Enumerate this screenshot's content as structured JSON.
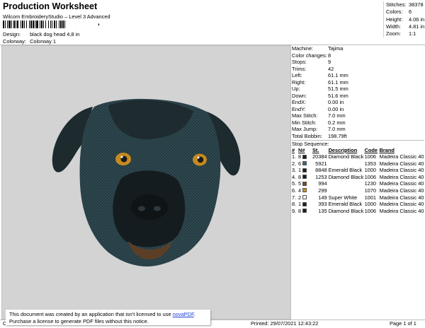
{
  "header": {
    "title": "Production Worksheet",
    "subtitle": "Wilcom EmbroideryStudio – Level 3 Advanced",
    "barcode_text": ",",
    "design_label": "Design:",
    "design_value": "black dog head 4,8 in",
    "colorway_label": "Colorway:",
    "colorway_value": "Colorway 1"
  },
  "stats": [
    {
      "label": "Stitches:",
      "value": "38378"
    },
    {
      "label": "Colors:",
      "value": "6"
    },
    {
      "label": "Height:",
      "value": "4.06 in"
    },
    {
      "label": "Width:",
      "value": "4.81 in"
    },
    {
      "label": "Zoom:",
      "value": "1:1"
    }
  ],
  "machine": [
    {
      "label": "Machine:",
      "value": "Tajima"
    },
    {
      "label": "Color changes:",
      "value": "8"
    },
    {
      "label": "Stops:",
      "value": "9"
    },
    {
      "label": "Trims:",
      "value": "42"
    },
    {
      "label": "Left:",
      "value": "61.1 mm"
    },
    {
      "label": "Right:",
      "value": "61.1 mm"
    },
    {
      "label": "Up:",
      "value": "51.5 mm"
    },
    {
      "label": "Down:",
      "value": "51.6 mm"
    },
    {
      "label": "EndX:",
      "value": "0.00 in"
    },
    {
      "label": "EndY:",
      "value": "0.00 in"
    },
    {
      "label": "Max Stitch:",
      "value": "7.0 mm"
    },
    {
      "label": "Min Stitch:",
      "value": "0.2 mm"
    },
    {
      "label": "Max Jump:",
      "value": "7.0 mm"
    },
    {
      "label": "Total Bobbin:",
      "value": "198.79ft"
    }
  ],
  "stop_sequence": {
    "heading": "Stop Sequence:",
    "columns": {
      "num": "#",
      "n": "N#",
      "st": "St.",
      "description": "Description",
      "code": "Code",
      "brand": "Brand"
    },
    "rows": [
      {
        "num": "1.",
        "n": "8",
        "color": "#1c1c1c",
        "st": "20384",
        "description": "Diamond Black",
        "code": "1006",
        "brand": "Madeira Classic 40"
      },
      {
        "num": "2.",
        "n": "6",
        "color": "#3f6470",
        "st": "5921",
        "description": "",
        "code": "1353",
        "brand": "Madeira Classic 40"
      },
      {
        "num": "3.",
        "n": "1",
        "color": "#1e1e1e",
        "st": "8848",
        "description": "Emerald Black",
        "code": "1000",
        "brand": "Madeira Classic 40"
      },
      {
        "num": "4.",
        "n": "8",
        "color": "#1c1c1c",
        "st": "1253",
        "description": "Diamond Black",
        "code": "1006",
        "brand": "Madeira Classic 40"
      },
      {
        "num": "5.",
        "n": "5",
        "color": "#6b4a2c",
        "st": "994",
        "description": "",
        "code": "1230",
        "brand": "Madeira Classic 40"
      },
      {
        "num": "6.",
        "n": "4",
        "color": "#c8921e",
        "st": "299",
        "description": "",
        "code": "1070",
        "brand": "Madeira Classic 40"
      },
      {
        "num": "7.",
        "n": "2",
        "color": "#f2f2f2",
        "st": "149",
        "description": "Super White",
        "code": "1001",
        "brand": "Madeira Classic 40"
      },
      {
        "num": "8.",
        "n": "1",
        "color": "#1e1e1e",
        "st": "393",
        "description": "Emerald Black",
        "code": "1000",
        "brand": "Madeira Classic 40"
      },
      {
        "num": "9.",
        "n": "8",
        "color": "#1c1c1c",
        "st": "135",
        "description": "Diamond Black",
        "code": "1006",
        "brand": "Madeira Classic 40"
      }
    ]
  },
  "footer": {
    "left": "Cr",
    "printed": "Printed: 29/07/2021 12:43:22",
    "page": "Page 1 of 1"
  },
  "notice": {
    "line1_prefix": "This document was created by an application that isn't licensed to use ",
    "line1_link": "novaPDF",
    "line1_suffix": ".",
    "line2": "Purchase a license to generate PDF files without this notice."
  },
  "colors": {
    "canvas": "#d3d3d3",
    "dog_fur": "#2f4a52",
    "dog_dark": "#141c20",
    "eye": "#c58a1f"
  }
}
